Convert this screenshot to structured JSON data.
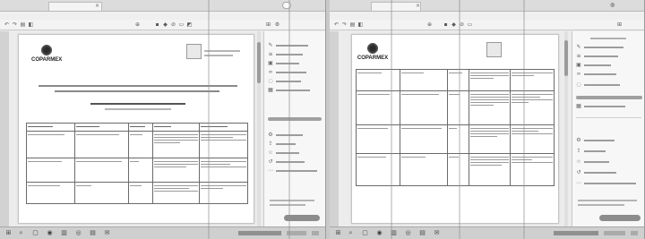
{
  "left": {
    "tab": "",
    "share_label": "",
    "menu": [
      "",
      "",
      ""
    ],
    "doc": {
      "brand": "COPARMEX",
      "subtitle": "",
      "seal_text": ""
    }
  },
  "right": {
    "tab": "",
    "menu": [
      "",
      "",
      ""
    ],
    "doc": {
      "brand": "COPARMEX",
      "subtitle": ""
    },
    "panel_heading": ""
  },
  "icons": {
    "toolbar": [
      "undo-icon",
      "redo-icon",
      "print-icon",
      "paint-format-icon",
      "zoom-icon",
      "bold-icon",
      "italic-icon",
      "link-icon",
      "comment-icon",
      "image-icon"
    ],
    "panel": [
      "edit-icon",
      "text-icon",
      "image-icon",
      "link-icon",
      "comment-icon",
      "table-icon",
      "settings-icon",
      "share-icon",
      "more-icon"
    ],
    "taskbar": [
      "start-icon",
      "search-icon",
      "task-view-icon",
      "edge-icon",
      "explorer-icon",
      "chrome-icon",
      "word-icon",
      "mail-icon"
    ]
  },
  "colors": {
    "page": "#ffffff",
    "workspace": "#ececec",
    "taskbar": "#cfcfcf",
    "button_fill": "#8c8c8c"
  }
}
